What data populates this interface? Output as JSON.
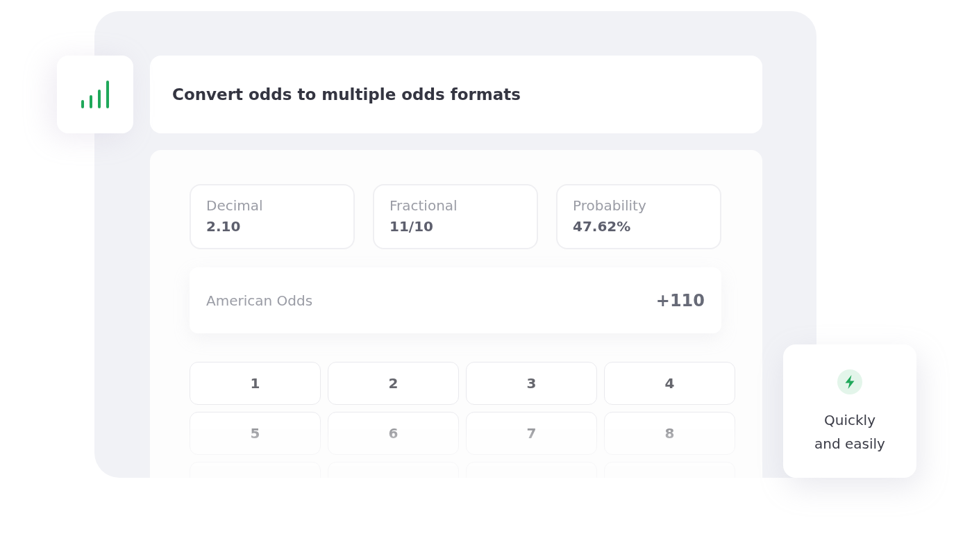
{
  "title": "Convert odds to multiple odds formats",
  "formats": [
    {
      "label": "Decimal",
      "value": "2.10"
    },
    {
      "label": "Fractional",
      "value": "11/10"
    },
    {
      "label": "Probability",
      "value": "47.62%"
    }
  ],
  "american_odds": {
    "label": "American Odds",
    "value": "+110"
  },
  "keypad": [
    {
      "kind": "digit",
      "label": "1"
    },
    {
      "kind": "digit",
      "label": "2"
    },
    {
      "kind": "digit",
      "label": "3"
    },
    {
      "kind": "digit",
      "label": "4"
    },
    {
      "kind": "digit",
      "label": "5"
    },
    {
      "kind": "digit",
      "label": "6"
    },
    {
      "kind": "digit",
      "label": "7"
    },
    {
      "kind": "digit",
      "label": "8"
    },
    {
      "kind": "clipped"
    },
    {
      "kind": "clipped"
    },
    {
      "kind": "clipped"
    },
    {
      "kind": "clipped"
    }
  ],
  "badge": {
    "text": "Quickly and easily"
  }
}
